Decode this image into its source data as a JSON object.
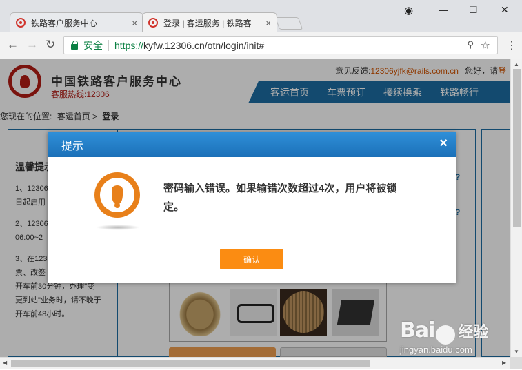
{
  "browser": {
    "tabs": [
      {
        "title": "铁路客户服务中心",
        "close": "×"
      },
      {
        "title": "登录 | 客运服务 | 铁路客",
        "close": "×"
      }
    ],
    "window_controls": {
      "minimize": "—",
      "maximize": "☐",
      "close": "✕"
    },
    "nav": {
      "back": "←",
      "forward": "→",
      "reload": "↻",
      "menu": "⋮"
    },
    "address": {
      "secure_label": "安全",
      "scheme": "https://",
      "host": "kyfw.12306.cn",
      "path": "/otn/login/init#"
    },
    "icons": {
      "key": "key-icon",
      "star": "star-icon",
      "profile": "profile-icon"
    }
  },
  "site": {
    "name": "中国铁路客户服务中心",
    "hotline": "客服热线:12306",
    "feedback_label": "意见反馈:",
    "feedback_email": "12306yjfk@rails.com.cn",
    "greeting": "您好，请",
    "register_partial": "登",
    "nav": [
      "客运首页",
      "车票预订",
      "接续换乘",
      "铁路畅行"
    ],
    "breadcrumb": {
      "prefix": "您现在的位置:",
      "home": "客运首页",
      "sep": ">",
      "current": "登录"
    },
    "notice_title": "温馨提示",
    "notices": [
      "1、12306",
      "日起启用",
      "2、12306",
      "06:00~2",
      "3、在123",
      "票、改签",
      "开车前30分钟，办理\"变",
      "更到站\"业务时，请不晚于",
      "开车前48小时。"
    ]
  },
  "dialog": {
    "title": "提示",
    "close": "×",
    "message": "密码输入错误。如果输错次数超过4次，用户将被锁定。",
    "confirm_label": "确认"
  },
  "colors": {
    "accent_blue": "#1c6ea4",
    "dialog_header": "#2f8fd8",
    "confirm_orange": "#fb8c12",
    "warning_orange": "#e8801a",
    "brand_red": "#b41d16"
  },
  "watermark": {
    "brand_left": "Bai",
    "brand_right": "经验",
    "url": "jingyan.baidu.com"
  }
}
